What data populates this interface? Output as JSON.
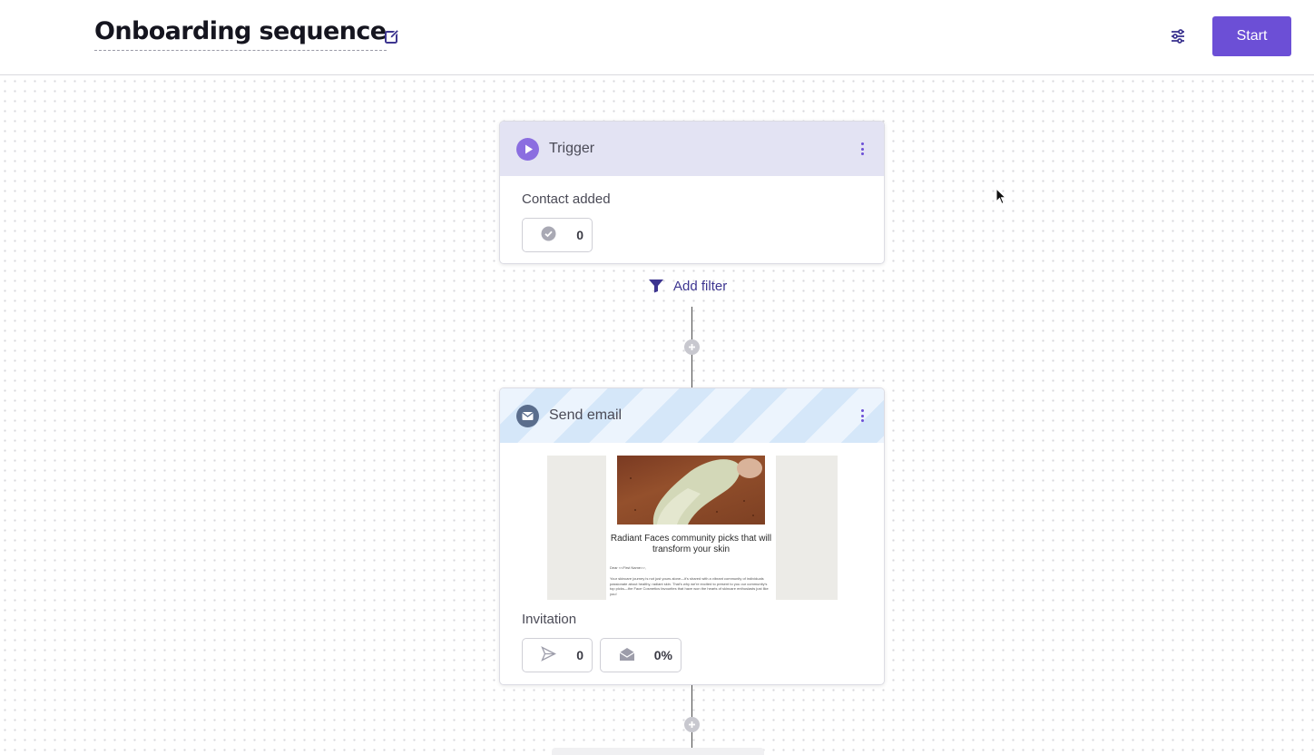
{
  "header": {
    "title": "Onboarding sequence",
    "start_label": "Start"
  },
  "colors": {
    "accent": "#6c4fd6",
    "trigger_header_bg": "#e3e3f3",
    "email_header_stripes": [
      "#ecf4fd",
      "#d5e7f9"
    ],
    "link": "#3d3590"
  },
  "trigger_node": {
    "title": "Trigger",
    "icon": "play-icon",
    "label": "Contact added",
    "stat_icon": "check-circle-icon",
    "stat_value": "0"
  },
  "add_filter_label": "Add filter",
  "email_node": {
    "title": "Send email",
    "icon": "envelope-icon",
    "label": "Invitation",
    "preview": {
      "heading": "Radiant Faces community picks that will transform your skin",
      "greeting": "Dear <<First Name>>,",
      "body": "Your skincare journey is not just yours alone—it's shared with a vibrant community of individuals passionate about healthy, radiant skin. That's why we're excited to present to you our community's top picks—the Face Cosmetics favourites that have won the hearts of skincare enthusiasts just like you!"
    },
    "sent_icon": "send-icon",
    "sent_value": "0",
    "opened_icon": "open-envelope-icon",
    "opened_value": "0%"
  }
}
